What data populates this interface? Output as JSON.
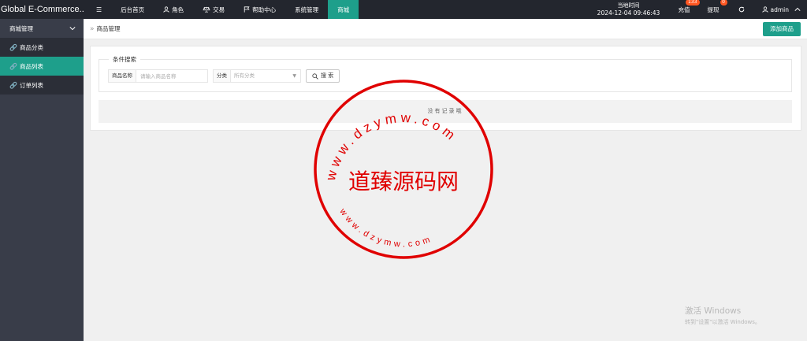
{
  "app": {
    "title": "Global E-Commerce..."
  },
  "topnav": [
    {
      "label": "",
      "icon": "menu-icon"
    },
    {
      "label": "后台首页",
      "icon": ""
    },
    {
      "label": "角色",
      "icon": "user-icon"
    },
    {
      "label": "交易",
      "icon": "scale-icon"
    },
    {
      "label": "帮助中心",
      "icon": "flag-icon"
    },
    {
      "label": "系统管理",
      "icon": ""
    },
    {
      "label": "商城",
      "icon": "",
      "active": true
    }
  ],
  "header": {
    "time_label": "当地时间",
    "time_value": "2024-12-04 09:46:43",
    "recharge_label": "充值",
    "recharge_badge": "133",
    "withdraw_label": "提现",
    "withdraw_badge": "0",
    "user_label": "admin"
  },
  "sidebar": {
    "group_label": "商城管理",
    "items": [
      {
        "label": "商品分类",
        "active": false
      },
      {
        "label": "商品列表",
        "active": true
      },
      {
        "label": "订单列表",
        "active": false
      }
    ]
  },
  "breadcrumb": {
    "current": "商品管理"
  },
  "toolbar": {
    "add_label": "添加商品"
  },
  "search": {
    "legend": "条件搜索",
    "name_label": "商品名称",
    "name_placeholder": "请输入商品名称",
    "category_label": "分类",
    "category_value": "所有分类",
    "button_label": "搜 索"
  },
  "table": {
    "empty_text": "没有记录哦"
  },
  "watermark": {
    "center_text": "道臻源码网",
    "top_arc": "www.dzymw.com",
    "bottom_arc": "www.dzymw.com",
    "color": "#e00000"
  },
  "windows_activation": {
    "title": "激活 Windows",
    "subtitle": "转到\"设置\"以激活 Windows。"
  },
  "colors": {
    "accent": "#1e9f8b",
    "topbar": "#23262e",
    "sidebar": "#393d49",
    "badge": "#ff5722"
  }
}
